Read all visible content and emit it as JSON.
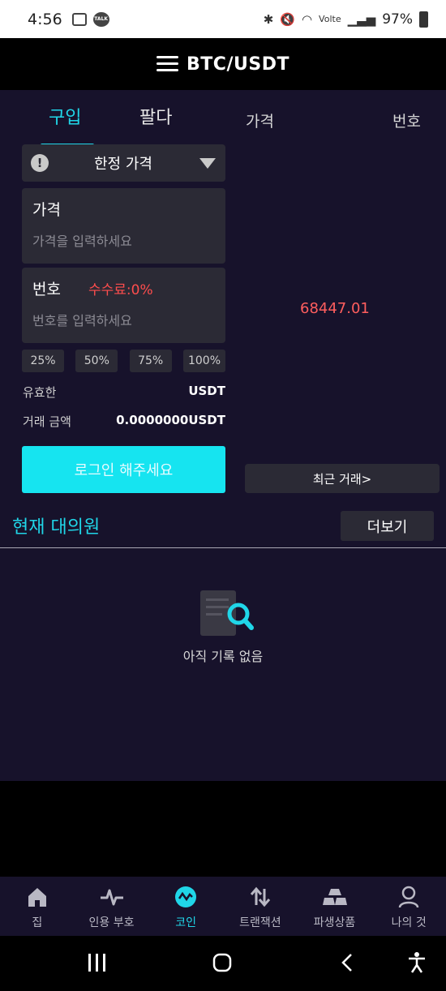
{
  "status_bar": {
    "time": "4:56",
    "talk_badge": "TALK",
    "network_label": "Volte",
    "battery": "97%"
  },
  "header": {
    "title": "BTC/USDT"
  },
  "trade": {
    "tabs": [
      {
        "label": "구입"
      },
      {
        "label": "팔다"
      }
    ],
    "order_type": "한정 가격",
    "price_label": "가격",
    "price_placeholder": "가격을 입력하세요",
    "amount_label": "번호",
    "fee_label": "수수료:0%",
    "amount_placeholder": "번호를 입력하세요",
    "percent_buttons": [
      "25%",
      "50%",
      "75%",
      "100%"
    ],
    "available_label": "유효한",
    "available_value": "USDT",
    "total_label": "거래 금액",
    "total_value": "0.0000000USDT",
    "login_button": "로그인 해주세요"
  },
  "orderbook": {
    "price_header": "가격",
    "number_header": "번호",
    "last_price": "68447.01",
    "recent_trades_button": "최근 거래>"
  },
  "current_orders": {
    "title": "현재 대의원",
    "more_button": "더보기",
    "empty_text": "아직 기록 없음"
  },
  "bottom_nav": [
    {
      "label": "집",
      "icon": "home-icon"
    },
    {
      "label": "인용 부호",
      "icon": "pulse-icon"
    },
    {
      "label": "코인",
      "icon": "coin-icon",
      "active": true
    },
    {
      "label": "트랜잭션",
      "icon": "swap-icon"
    },
    {
      "label": "파생상품",
      "icon": "gold-bars-icon"
    },
    {
      "label": "나의 것",
      "icon": "user-icon"
    }
  ],
  "colors": {
    "accent": "#20d6e8",
    "background": "#17122b",
    "panel": "#2b2a35",
    "price_red": "#ff5e5e",
    "login_button": "#16e4f0"
  }
}
